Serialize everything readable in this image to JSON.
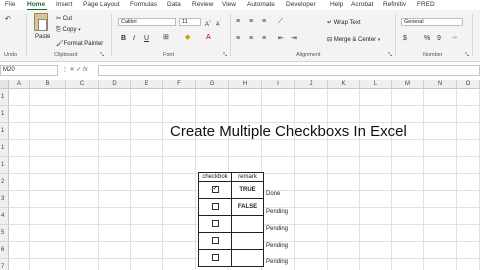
{
  "tabs": [
    "File",
    "Home",
    "Insert",
    "Page Layout",
    "Formulas",
    "Data",
    "Review",
    "View",
    "Automate",
    "Developer",
    "Help",
    "Acrobat",
    "Refinitiv",
    "FRED"
  ],
  "ribbon": {
    "clipboard": {
      "paste_label": "Paste",
      "cut_label": "Cut",
      "copy_label": "Copy",
      "format_painter_label": "Format Painter",
      "group_label": "Clipboard"
    },
    "undo_label": "Undo",
    "font": {
      "font_name": "Calibri",
      "font_size": "11",
      "bold": "B",
      "italic": "I",
      "underline": "U",
      "grow": "A",
      "shrink": "A",
      "group_label": "Font"
    },
    "alignment": {
      "wrap_text_label": "Wrap Text",
      "merge_label": "Merge & Center",
      "group_label": "Alignment"
    },
    "number": {
      "format": "General",
      "currency": "$",
      "percent": "%",
      "comma": "9",
      "group_label": "Number"
    }
  },
  "formula_bar": {
    "name_box": "M20",
    "fx": "fx",
    "formula": ""
  },
  "grid": {
    "columns": [
      "A",
      "B",
      "C",
      "D",
      "E",
      "F",
      "G",
      "H",
      "I",
      "J",
      "K",
      "L",
      "M",
      "N",
      "O"
    ],
    "rows": [
      "1",
      "1",
      "1",
      "1",
      "1",
      "2",
      "3",
      "4",
      "5",
      "6",
      "7"
    ]
  },
  "sheet": {
    "title": "Create Multiple Checkboxs  In Excel",
    "table": {
      "header_checkbox": "checkbok",
      "header_remark": "remark",
      "rows": [
        {
          "checked": true,
          "value": "TRUE",
          "status": "Done"
        },
        {
          "checked": false,
          "value": "FALSE",
          "status": "Pending"
        },
        {
          "checked": false,
          "value": "",
          "status": "Pending"
        },
        {
          "checked": false,
          "value": "",
          "status": "Pending"
        },
        {
          "checked": false,
          "value": "",
          "status": "Pending"
        }
      ]
    }
  },
  "colors": {
    "accent": "#1e6b3a",
    "ribbon_bg": "#f3f3f3",
    "header_bg": "#efefef"
  }
}
